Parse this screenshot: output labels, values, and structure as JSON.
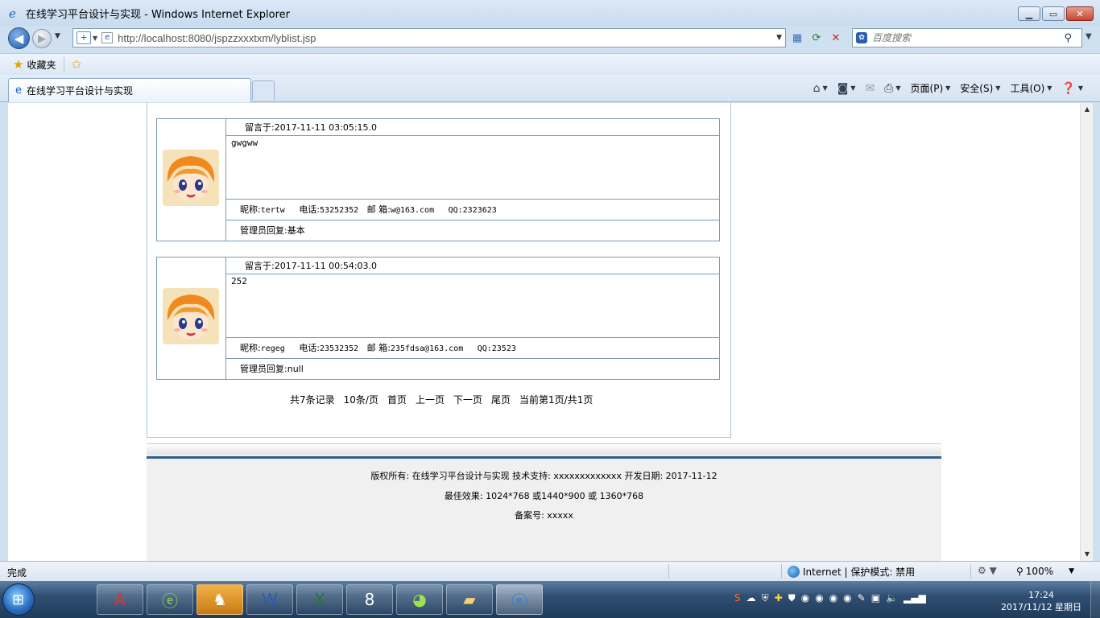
{
  "window": {
    "title": "在线学习平台设计与实现 - Windows Internet Explorer"
  },
  "address_bar": {
    "url": "http://localhost:8080/jspzzxxxtxm/lyblist.jsp"
  },
  "search": {
    "placeholder": "百度搜索"
  },
  "favorites": {
    "label": "收藏夹"
  },
  "tab": {
    "label": "在线学习平台设计与实现"
  },
  "command_bar": {
    "page": "页面(P)",
    "safety": "安全(S)",
    "tools": "工具(O)"
  },
  "messages": [
    {
      "header_label": "留言于:",
      "time": "2017-11-11 03:05:15.0",
      "content": "gwgww",
      "nickname_label": "昵称:",
      "nickname": "tertw",
      "phone_label": "电话:",
      "phone": "53252352",
      "email_label": "邮 箱:",
      "email": "w@163.com",
      "qq_label": "QQ:",
      "qq": "2323623",
      "reply_label": "管理员回复:",
      "reply": "基本"
    },
    {
      "header_label": "留言于:",
      "time": "2017-11-11 00:54:03.0",
      "content": "252",
      "nickname_label": "昵称:",
      "nickname": "regeg",
      "phone_label": "电话:",
      "phone": "23532352",
      "email_label": "邮 箱:",
      "email": "235fdsa@163.com",
      "qq_label": "QQ:",
      "qq": "23523",
      "reply_label": "管理员回复:",
      "reply": "null"
    }
  ],
  "pager": {
    "total": "共7条记录",
    "per_page": "10条/页",
    "first": "首页",
    "prev": "上一页",
    "next": "下一页",
    "last": "尾页",
    "current": "当前第1页/共1页"
  },
  "footer": {
    "line1": "版权所有: 在线学习平台设计与实现 技术支持: xxxxxxxxxxxxx 开发日期: 2017-11-12",
    "line2": "最佳效果: 1024*768 或1440*900 或 1360*768",
    "line3": "备案号: xxxxx"
  },
  "status_bar": {
    "status": "完成",
    "zone": "Internet | 保护模式: 禁用",
    "zoom": "100%"
  },
  "clock": {
    "time": "17:24",
    "date": "2017/11/12 星期日"
  },
  "icons": {
    "ie_accent": "#1e63b6",
    "title_bar_bg": "#d6e4f3"
  }
}
